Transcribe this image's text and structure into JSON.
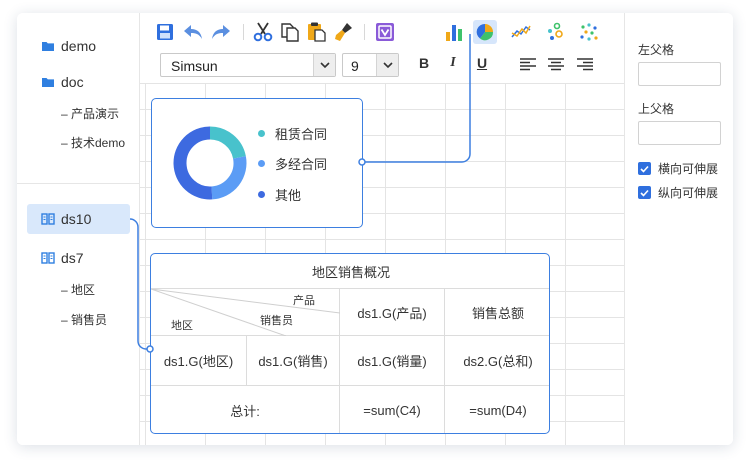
{
  "tree": {
    "folders": [
      {
        "label": "demo",
        "icon": "folder-icon"
      },
      {
        "label": "doc",
        "icon": "folder-icon",
        "children": [
          "– 产品演示",
          "– 技术demo"
        ]
      }
    ],
    "datasets": [
      {
        "label": "ds10",
        "icon": "dataset-icon",
        "selected": true
      },
      {
        "label": "ds7",
        "icon": "dataset-icon",
        "children": [
          "– 地区",
          "– 销售员"
        ]
      }
    ]
  },
  "toolbar": {
    "icons": [
      "save-icon",
      "undo-icon",
      "redo-icon",
      "cut-icon",
      "copy-icon",
      "paste-icon",
      "format-painter-icon",
      "preview-icon",
      "bar-chart-icon",
      "pie-chart-icon",
      "line-chart-icon",
      "scatter-chart-icon",
      "bubble-chart-icon"
    ],
    "active_icon": "pie-chart-icon",
    "font_family": "Simsun",
    "font_size": "9",
    "bold": "B",
    "italic": "I",
    "underline": "U"
  },
  "chart": {
    "legend": [
      "租赁合同",
      "多经合同",
      "其他"
    ],
    "colors": [
      "#48c2cc",
      "#5b9cf5",
      "#3d6ae0"
    ],
    "chart_data": {
      "type": "pie",
      "categories": [
        "租赁合同",
        "多经合同",
        "其他"
      ],
      "values": [
        22,
        27,
        51
      ],
      "donut": true
    }
  },
  "report": {
    "title": "地区销售概况",
    "header_product": "产品",
    "header_salesman": "销售员",
    "header_region": "地区",
    "col_product": "ds1.G(产品)",
    "col_total": "销售总额",
    "row_region": "ds1.G(地区)",
    "row_salesman": "ds1.G(销售)",
    "row_qty": "ds1.G(销量)",
    "row_sum": "ds2.G(总和)",
    "total_label": "总计:",
    "total_c4": "=sum(C4)",
    "total_d4": "=sum(D4)"
  },
  "props": {
    "left_parent_label": "左父格",
    "left_parent_value": "",
    "top_parent_label": "上父格",
    "top_parent_value": "",
    "h_expand_label": "横向可伸展",
    "h_expand_checked": true,
    "v_expand_label": "纵向可伸展",
    "v_expand_checked": true
  }
}
